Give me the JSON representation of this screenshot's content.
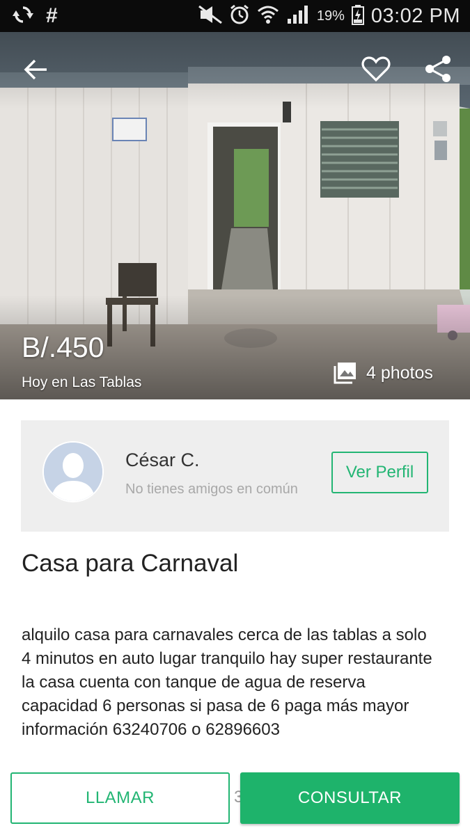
{
  "status_bar": {
    "battery_percent": "19%",
    "time": "03:02 PM",
    "hash": "#"
  },
  "listing": {
    "price": "B/.450",
    "posted": "Hoy en Las Tablas",
    "photos_label": "4 photos",
    "title": "Casa para Carnaval",
    "description": "alquilo casa para carnavales cerca de las tablas a solo 4 minutos en auto lugar tranquilo hay super restaurante la casa cuenta con tanque de agua de reserva capacidad 6 personas si pasa de 6 paga más mayor información 63240706 o 62896603"
  },
  "seller": {
    "name": "César C.",
    "mutual": "No tienes amigos en común",
    "profile_button": "Ver Perfil"
  },
  "actions": {
    "call": "LLAMAR",
    "ask": "CONSULTAR",
    "hidden_char": "3"
  },
  "colors": {
    "accent": "#1eb36b",
    "status_bar": "#0b0b0b",
    "card_bg": "#eeeeee"
  },
  "icons": {
    "back": "arrow-left-icon",
    "favorite": "heart-outline-icon",
    "share": "share-icon",
    "photos": "photo-library-icon"
  }
}
